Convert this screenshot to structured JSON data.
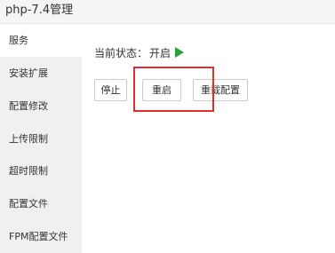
{
  "window": {
    "title": "php-7.4管理"
  },
  "sidebar": {
    "items": [
      {
        "label": "服务",
        "active": true
      },
      {
        "label": "安装扩展"
      },
      {
        "label": "配置修改"
      },
      {
        "label": "上传限制"
      },
      {
        "label": "超时限制"
      },
      {
        "label": "配置文件"
      },
      {
        "label": "FPM配置文件"
      }
    ]
  },
  "main": {
    "status_label": "当前状态：",
    "status_value": "开启",
    "status_icon": "play-icon",
    "status_color": "#20a53a",
    "buttons": {
      "stop": "停止",
      "restart": "重启",
      "reload": "重载配置"
    }
  },
  "colors": {
    "highlight": "#e02d2d",
    "sidebar_bg": "#f0f0f0"
  }
}
